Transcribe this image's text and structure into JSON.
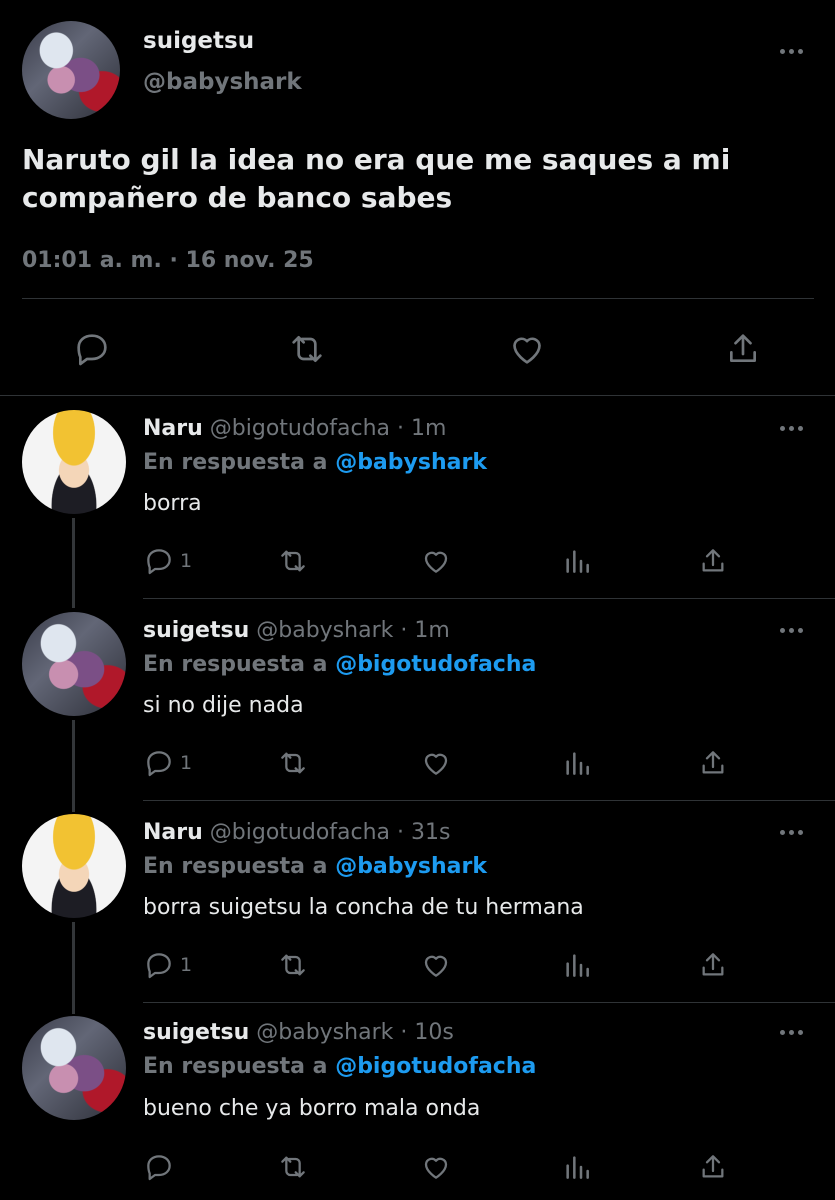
{
  "main_tweet": {
    "display_name": "suigetsu",
    "handle": "@babyshark",
    "text_line1": "Naruto gil la idea no era que me saques a mi",
    "text_line2": "compañero de banco sabes",
    "timestamp": "01:01 a. m. · 16 nov. 25"
  },
  "replies": [
    {
      "display_name": "Naru",
      "handle_time": "@bigotudofacha · 1m",
      "reply_prefix": "En respuesta a",
      "reply_to": "@babyshark",
      "text": "borra",
      "reply_count": "1"
    },
    {
      "display_name": "suigetsu",
      "handle_time": "@babyshark · 1m",
      "reply_prefix": "En respuesta a",
      "reply_to": "@bigotudofacha",
      "text": "si no dije nada",
      "reply_count": "1"
    },
    {
      "display_name": "Naru",
      "handle_time": "@bigotudofacha · 31s",
      "reply_prefix": "En respuesta a",
      "reply_to": "@babyshark",
      "text": "borra suigetsu la concha de tu hermana",
      "reply_count": "1"
    },
    {
      "display_name": "suigetsu",
      "handle_time": "@babyshark · 10s",
      "reply_prefix": "En respuesta a",
      "reply_to": "@bigotudofacha",
      "text": "bueno che ya borro mala onda",
      "reply_count": ""
    }
  ],
  "colors": {
    "background": "#000000",
    "text": "#e7e9ea",
    "muted": "#71767b",
    "link": "#1d9bf0",
    "divider": "#2f3336"
  },
  "icons": [
    "reply-icon",
    "retweet-icon",
    "like-icon",
    "share-icon",
    "analytics-icon",
    "more-icon"
  ]
}
